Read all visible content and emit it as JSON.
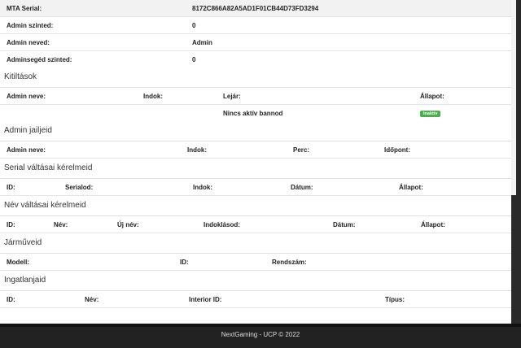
{
  "info": [
    {
      "label": "MTA Serial:",
      "value": "8172C866A82A5AD1F01CB44D73FD3294"
    },
    {
      "label": "Admin szinted:",
      "value": "0"
    },
    {
      "label": "Admin neved:",
      "value": "Admin"
    },
    {
      "label": "Adminsegéd szinted:",
      "value": "0"
    }
  ],
  "bans": {
    "title": "Kitiltások",
    "headers": [
      "Admin neve:",
      "Indok:",
      "Lejár:",
      "Állapot:"
    ],
    "empty_text": "Nincs aktív bannod",
    "status_badge": "Inaktív"
  },
  "jails": {
    "title": "Admin jailjeid",
    "headers": [
      "Admin neve:",
      "Indok:",
      "Perc:",
      "Időpont:"
    ]
  },
  "serial_requests": {
    "title": "Serial váltásai kérelmeid",
    "headers": [
      "ID:",
      "Serialod:",
      "Indok:",
      "Dátum:",
      "Állapot:"
    ]
  },
  "name_requests": {
    "title": "Név váltásai kérelmeid",
    "headers": [
      "ID:",
      "Név:",
      "Új név:",
      "Indoklásod:",
      "Dátum:",
      "Állapot:"
    ]
  },
  "vehicles": {
    "title": "Járműveid",
    "headers": [
      "Modell:",
      "ID:",
      "Rendszám:"
    ]
  },
  "properties": {
    "title": "Ingatlanjaid",
    "headers": [
      "ID:",
      "Név:",
      "Interior ID:",
      "Típus:"
    ]
  },
  "footer": {
    "text": "NextGaming - UCP © 2022"
  },
  "colors": {
    "status_inactive": "#4cae4c",
    "footer_bg": "#222222"
  }
}
